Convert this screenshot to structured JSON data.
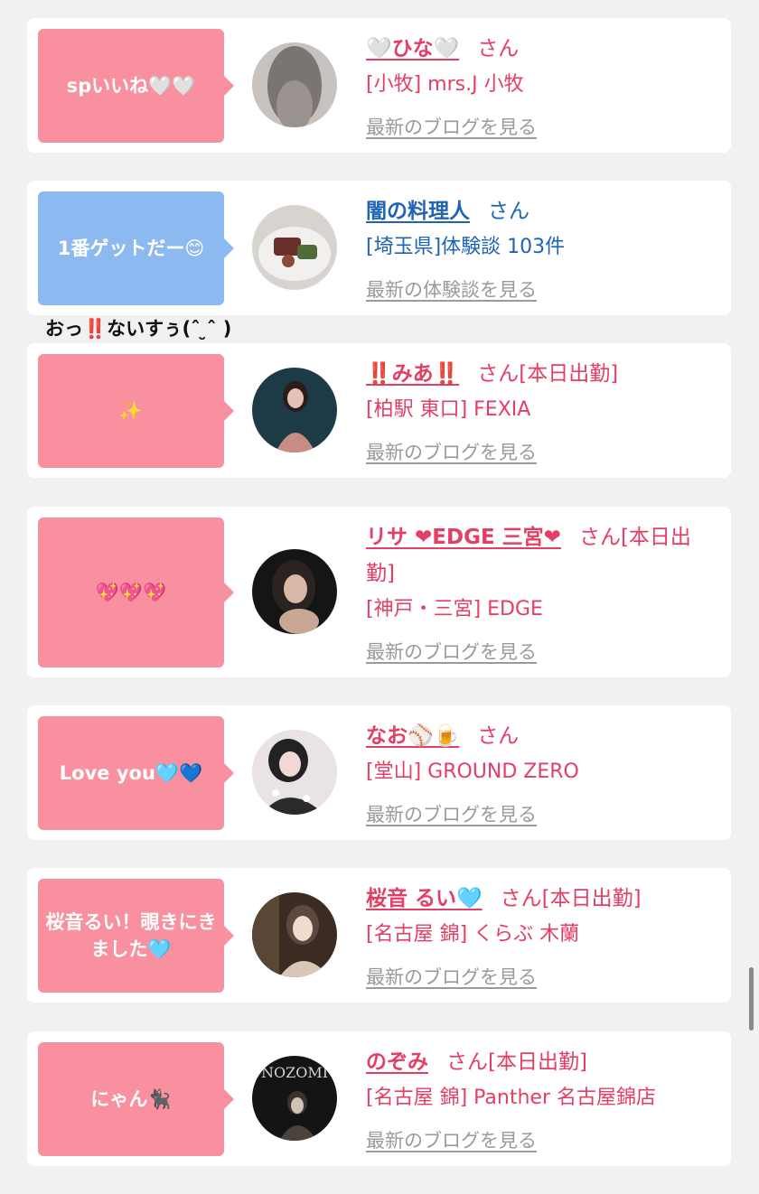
{
  "caption": "おっ‼️ないすぅ(ˆ ̮ˆ )",
  "entries": [
    {
      "bubble": "spいいね🤍🤍",
      "name": "🤍ひな🤍",
      "suffix": "さん",
      "shop": "[小牧] mrs.J 小牧",
      "more": "最新のブログを見る",
      "color": "pink",
      "avatar_colors": [
        "#8f8b8a",
        "#bdb7b3"
      ]
    },
    {
      "bubble": "1番ゲットだー😊",
      "name": "闇の料理人",
      "suffix": "さん",
      "shop": "[埼玉県]体験談 103件",
      "more": "最新の体験談を見る",
      "color": "blue",
      "avatar_colors": [
        "#6e3b35",
        "#e9e6e3"
      ]
    },
    {
      "bubble": "✨",
      "name": "‼️みあ‼️",
      "suffix": "さん[本日出勤]",
      "shop": "[柏駅 東口] FEXIA",
      "more": "最新のブログを見る",
      "color": "pink",
      "avatar_colors": [
        "#1c3640",
        "#d7a59a"
      ]
    },
    {
      "bubble": "💖💖💖",
      "name": "リサ ❤EDGE 三宮❤",
      "suffix": "さん[本日出勤]",
      "shop": "[神戸・三宮] EDGE",
      "more": "最新のブログを見る",
      "color": "pink",
      "avatar_colors": [
        "#1b1b1b",
        "#cfa690"
      ]
    },
    {
      "bubble": "Love you🩵💙",
      "name": "なお⚾️🍺",
      "suffix": "さん",
      "shop": "[堂山] GROUND ZERO",
      "more": "最新のブログを見る",
      "color": "pink",
      "avatar_colors": [
        "#2a2a2a",
        "#e8d0d0"
      ]
    },
    {
      "bubble": "桜音るい！覗きにきました🩵",
      "name": "桜音 るい🩵",
      "suffix": "さん[本日出勤]",
      "shop": "[名古屋 錦] くらぶ 木蘭",
      "more": "最新のブログを見る",
      "color": "pink",
      "avatar_colors": [
        "#3a2a22",
        "#e2cfc1"
      ]
    },
    {
      "bubble": "にゃん🐈‍⬛",
      "name": "のぞみ",
      "suffix": "さん[本日出勤]",
      "shop": "[名古屋 錦] Panther 名古屋錦店",
      "more": "最新のブログを見る",
      "color": "pink",
      "avatar_colors": [
        "#101010",
        "#bdb6ad"
      ],
      "avatar_text": "NOZOMI"
    }
  ]
}
